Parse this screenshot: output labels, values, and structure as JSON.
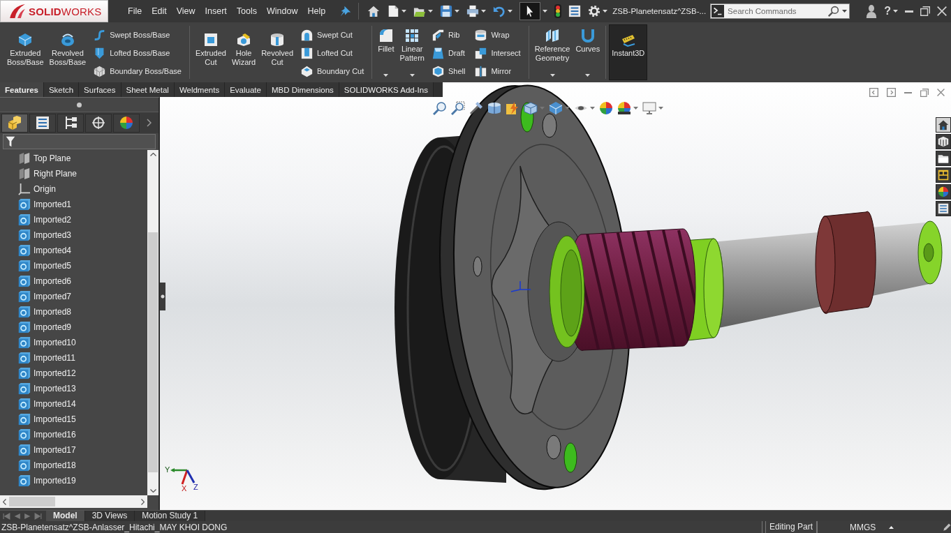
{
  "window": {
    "title": "ZSB-Planetensatz^ZSB-..."
  },
  "menu_bar": {
    "logo": "**SOLID**WORKS",
    "menus": [
      "File",
      "Edit",
      "View",
      "Insert",
      "Tools",
      "Window",
      "Help"
    ],
    "select_tool": {
      "selected": true
    },
    "help": "?"
  },
  "search": {
    "placeholder": "Search Commands"
  },
  "ribbon": [
    {
      "large": [
        {
          "label": "Extruded Boss/Base",
          "dropdown": false
        },
        {
          "label": "Revolved Boss/Base",
          "dropdown": false
        }
      ],
      "stacks": [
        [
          "Swept Boss/Base",
          "Lofted Boss/Base",
          "Boundary Boss/Base"
        ]
      ]
    },
    {
      "large": [
        {
          "label": "Extruded Cut",
          "dropdown": false
        },
        {
          "label": "Hole Wizard",
          "dropdown": false
        },
        {
          "label": "Revolved Cut",
          "dropdown": false
        }
      ],
      "stacks": [
        [
          "Swept Cut",
          "Lofted Cut",
          "Boundary Cut"
        ]
      ]
    },
    {
      "large": [
        {
          "label": "Fillet",
          "dropdown": true
        },
        {
          "label": "Linear Pattern",
          "dropdown": true
        }
      ],
      "stacks": [
        [
          "Rib",
          "Draft",
          "Shell"
        ],
        [
          "Wrap",
          "Intersect",
          "Mirror"
        ]
      ]
    },
    {
      "large": [
        {
          "label": "Reference Geometry",
          "dropdown": true
        },
        {
          "label": "Curves",
          "dropdown": true
        }
      ]
    }
  ],
  "instant3d": {
    "label": "Instant3D",
    "selected": true
  },
  "command_tabs": [
    {
      "label": "Features",
      "selected": true
    },
    {
      "label": "Sketch",
      "selected": false
    },
    {
      "label": "Surfaces",
      "selected": false
    },
    {
      "label": "Sheet Metal",
      "selected": false
    },
    {
      "label": "Weldments",
      "selected": false
    },
    {
      "label": "Evaluate",
      "selected": false
    },
    {
      "label": "MBD Dimensions",
      "selected": false
    },
    {
      "label": "SOLIDWORKS Add-Ins",
      "selected": false
    }
  ],
  "panel_tabs": [
    {
      "kind": "features",
      "selected": true
    },
    {
      "kind": "properties",
      "selected": false
    },
    {
      "kind": "configurations",
      "selected": false
    },
    {
      "kind": "dimxpert",
      "selected": false
    },
    {
      "kind": "display",
      "selected": false
    }
  ],
  "feature_tree": [
    {
      "kind": "plane",
      "label": "Top Plane"
    },
    {
      "kind": "plane",
      "label": "Right Plane"
    },
    {
      "kind": "origin",
      "label": "Origin"
    },
    {
      "kind": "body",
      "label": "Imported1"
    },
    {
      "kind": "body",
      "label": "Imported2"
    },
    {
      "kind": "body",
      "label": "Imported3"
    },
    {
      "kind": "body",
      "label": "Imported4"
    },
    {
      "kind": "body",
      "label": "Imported5"
    },
    {
      "kind": "body",
      "label": "Imported6"
    },
    {
      "kind": "body",
      "label": "Imported7"
    },
    {
      "kind": "body",
      "label": "Imported8"
    },
    {
      "kind": "body",
      "label": "Imported9"
    },
    {
      "kind": "body",
      "label": "Imported10"
    },
    {
      "kind": "body",
      "label": "Imported11"
    },
    {
      "kind": "body",
      "label": "Imported12"
    },
    {
      "kind": "body",
      "label": "Imported13"
    },
    {
      "kind": "body",
      "label": "Imported14"
    },
    {
      "kind": "body",
      "label": "Imported15"
    },
    {
      "kind": "body",
      "label": "Imported16"
    },
    {
      "kind": "body",
      "label": "Imported17"
    },
    {
      "kind": "body",
      "label": "Imported18"
    },
    {
      "kind": "body",
      "label": "Imported19"
    }
  ],
  "task_pane": [
    {
      "kind": "home",
      "selected": true
    },
    {
      "kind": "library",
      "selected": false
    },
    {
      "kind": "files",
      "selected": false
    },
    {
      "kind": "palette",
      "selected": false
    },
    {
      "kind": "appearances",
      "selected": false
    },
    {
      "kind": "properties",
      "selected": false
    }
  ],
  "triad": {
    "axes": [
      "Y",
      "X",
      "Z"
    ]
  },
  "model_tabs": [
    {
      "label": "Model",
      "selected": true
    },
    {
      "label": "3D Views",
      "selected": false
    },
    {
      "label": "Motion Study 1",
      "selected": false
    }
  ],
  "status_bar": {
    "document": "ZSB-Planetensatz^ZSB-Anlasser_Hitachi_MAY KHOI DONG",
    "mode": "Editing Part",
    "units": "MMGS"
  }
}
